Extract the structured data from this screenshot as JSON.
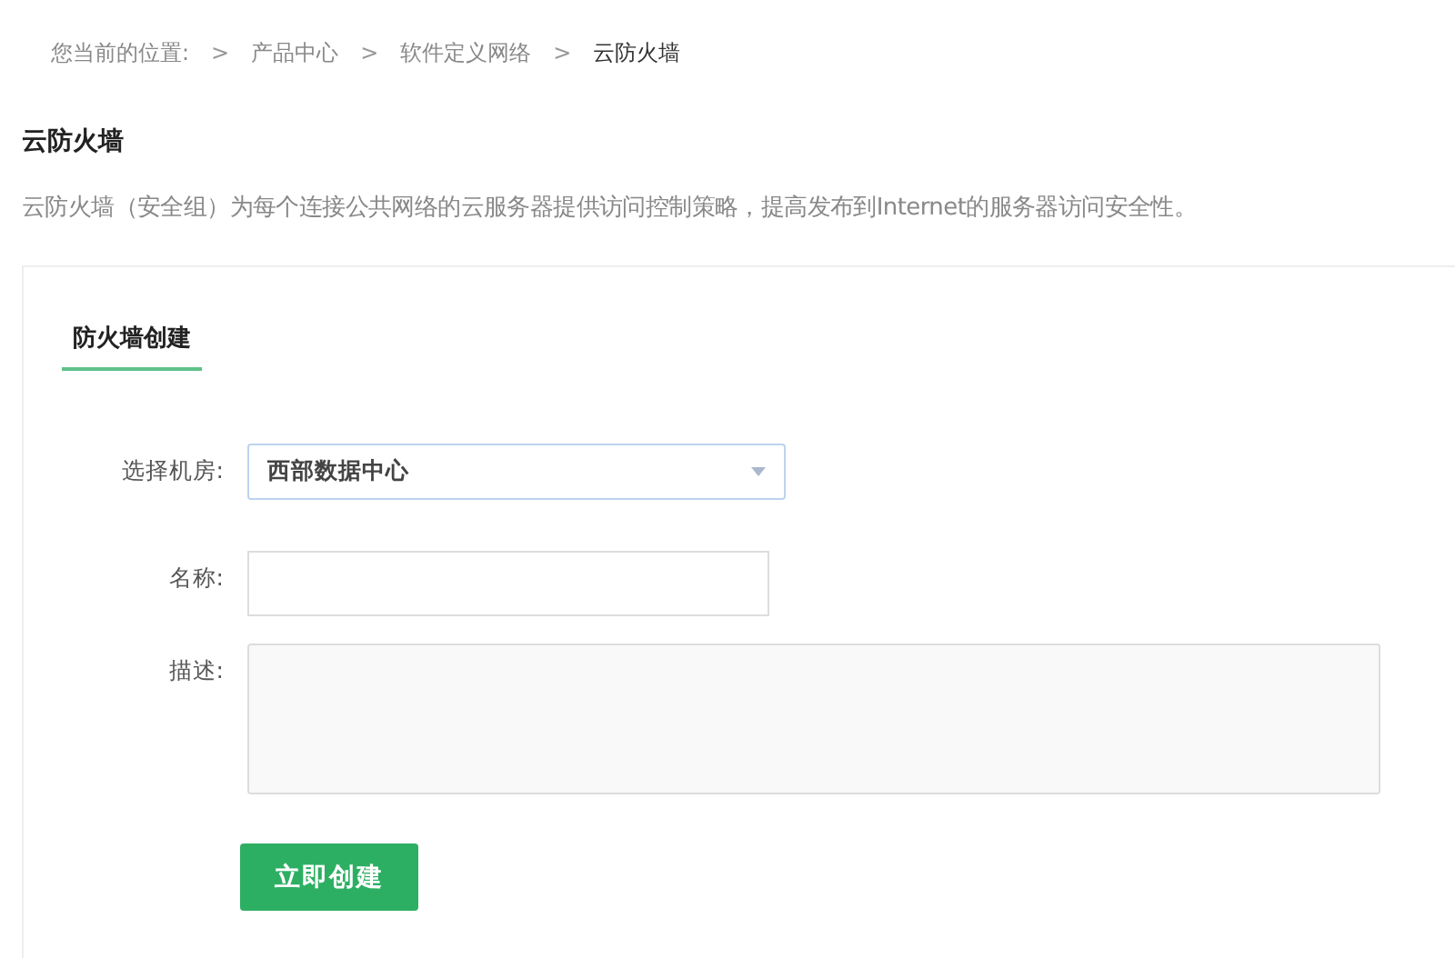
{
  "breadcrumb": {
    "prefix": "您当前的位置:",
    "separator": ">",
    "items": [
      {
        "label": "产品中心",
        "selected": false
      },
      {
        "label": "软件定义网络",
        "selected": false
      },
      {
        "label": "云防火墙",
        "selected": true
      }
    ]
  },
  "title": "云防火墙",
  "description": "云防火墙（安全组）为每个连接公共网络的云服务器提供访问控制策略，提高发布到Internet的服务器访问安全性。",
  "tabs": [
    {
      "label": "防火墙创建",
      "selected": true
    }
  ],
  "form": {
    "fields": [
      {
        "kind": "select",
        "label": "选择机房:",
        "value": "西部数据中心"
      },
      {
        "kind": "text",
        "label": "名称:"
      },
      {
        "kind": "textarea",
        "label": "描述:"
      }
    ],
    "submit": "立即创建"
  }
}
